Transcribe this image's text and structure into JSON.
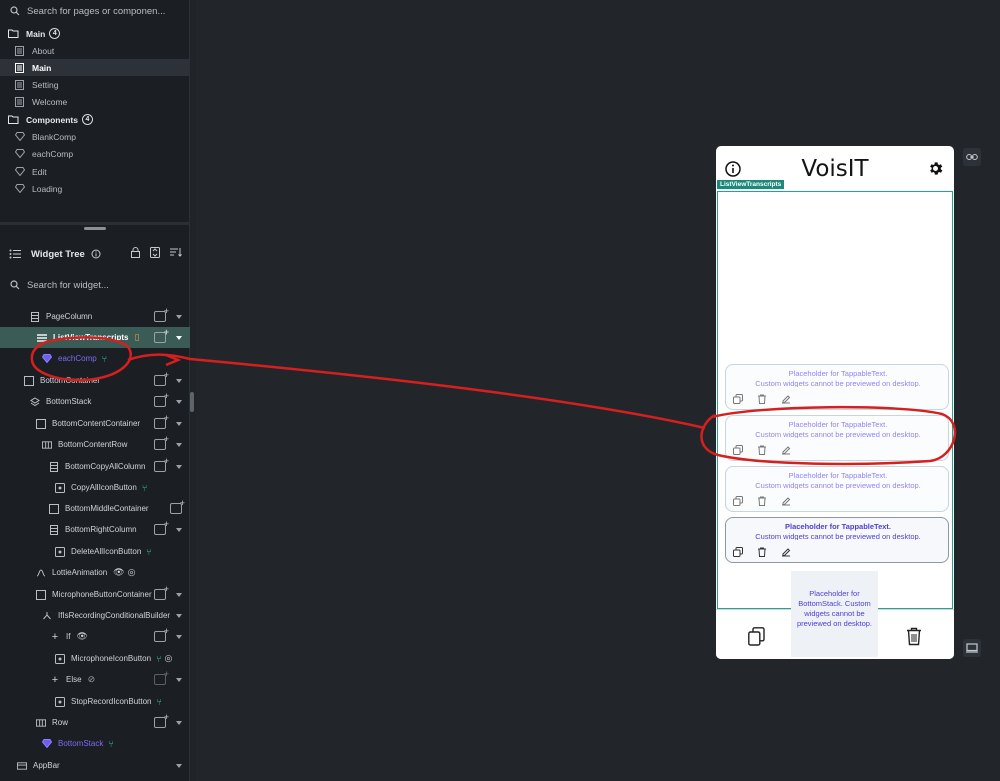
{
  "pages_search": {
    "placeholder": "Search for pages or componen..."
  },
  "pages": {
    "main_folder": {
      "label": "Main",
      "count": "4"
    },
    "main_items": [
      {
        "label": "About",
        "selected": false
      },
      {
        "label": "Main",
        "selected": true
      },
      {
        "label": "Setting",
        "selected": false
      },
      {
        "label": "Welcome",
        "selected": false
      }
    ],
    "components_folder": {
      "label": "Components",
      "count": "4"
    },
    "component_items": [
      {
        "label": "BlankComp"
      },
      {
        "label": "eachComp"
      },
      {
        "label": "Edit"
      },
      {
        "label": "Loading"
      }
    ]
  },
  "widget_tree": {
    "title": "Widget Tree",
    "search_placeholder": "Search for widget...",
    "rows": [
      {
        "label": "PageColumn"
      },
      {
        "label": "ListViewTranscripts"
      },
      {
        "label": "eachComp"
      },
      {
        "label": "BottomContainer"
      },
      {
        "label": "BottomStack"
      },
      {
        "label": "BottomContentContainer"
      },
      {
        "label": "BottomContentRow"
      },
      {
        "label": "BottomCopyAllColumn"
      },
      {
        "label": "CopyAllIconButton"
      },
      {
        "label": "BottomMiddleContainer"
      },
      {
        "label": "BottomRightColumn"
      },
      {
        "label": "DeleteAllIconButton"
      },
      {
        "label": "LottieAnimation"
      },
      {
        "label": "MicrophoneButtonContainer"
      },
      {
        "label": "IfIsRecordingConditionalBuilder"
      },
      {
        "label": "If"
      },
      {
        "label": "MicrophoneIconButton"
      },
      {
        "label": "Else"
      },
      {
        "label": "StopRecordIconButton"
      },
      {
        "label": "Row"
      },
      {
        "label": "BottomStack"
      },
      {
        "label": "AppBar"
      }
    ]
  },
  "phone": {
    "title": "VoisIT",
    "listview_tag": "ListViewTranscripts",
    "cards": [
      {
        "line1": "Placeholder for TappableText.",
        "line2": "Custom widgets cannot be previewed on desktop."
      },
      {
        "line1": "Placeholder for TappableText.",
        "line2": "Custom widgets cannot be previewed on desktop."
      },
      {
        "line1": "Placeholder for TappableText.",
        "line2": "Custom widgets cannot be previewed on desktop."
      },
      {
        "line1": "Placeholder for TappableText.",
        "line2": "Custom widgets cannot be previewed on desktop."
      }
    ],
    "bottom_stack_placeholder": "Placeholder for BottomStack. Custom widgets cannot be previewed on desktop."
  },
  "colors": {
    "accent_teal": "#22a58f",
    "component_purple": "#7b6cf0",
    "annotation_red": "#d61f1f"
  }
}
